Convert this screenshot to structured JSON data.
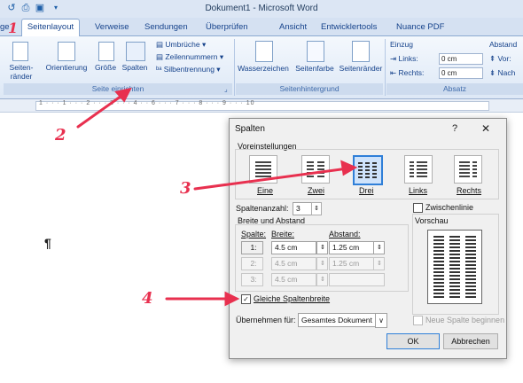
{
  "window": {
    "title": "Dokument1 - Microsoft Word"
  },
  "tabs": [
    "ge",
    "Seitenlayout",
    "Verweise",
    "Sendungen",
    "Überprüfen",
    "Ansicht",
    "Entwicklertools",
    "Nuance PDF"
  ],
  "ribbon": {
    "seite_einrichten": {
      "label": "Seite einrichten",
      "seitenraender": "Seiten-\nränder",
      "orientierung": "Orientierung",
      "groesse": "Größe",
      "spalten": "Spalten",
      "umbrueche": "Umbrüche",
      "zeilennummern": "Zeilennummern",
      "silbentrennung": "Silbentrennung"
    },
    "seitenhintergrund": {
      "label": "Seitenhintergrund",
      "wasserzeichen": "Wasserzeichen",
      "seitenfarbe": "Seitenfarbe",
      "seitenraender": "Seitenränder"
    },
    "absatz": {
      "label": "Absatz",
      "einzug": "Einzug",
      "links_label": "Links:",
      "links_value": "0 cm",
      "rechts_label": "Rechts:",
      "rechts_value": "0 cm",
      "abstand": "Abstand",
      "vor": "Vor:",
      "nach": "Nach"
    }
  },
  "ruler": {
    "ticks": "1 · · · 1 · · · 2 · · · 3 · · · 4 · ·   6 · · · 7 · · · 8 · · · 9 · · · 10"
  },
  "document": {
    "pilcrow": "¶"
  },
  "annotations": [
    "1",
    "2",
    "3",
    "4"
  ],
  "dialog": {
    "title": "Spalten",
    "help": "?",
    "close": "✕",
    "presets_label": "Voreinstellungen",
    "presets": [
      "Eine",
      "Zwei",
      "Drei",
      "Links",
      "Rechts"
    ],
    "selected_preset": "Drei",
    "spaltenanzahl_label": "Spaltenanzahl:",
    "spaltenanzahl_value": "3",
    "zwischenlinie": "Zwischenlinie",
    "zwischenlinie_checked": false,
    "breite_abstand_label": "Breite und Abstand",
    "col_spalte": "Spalte:",
    "col_breite": "Breite:",
    "col_abstand": "Abstand:",
    "rows": [
      {
        "num": "1:",
        "breite": "4.5 cm",
        "abstand": "1.25 cm"
      },
      {
        "num": "2:",
        "breite": "4.5 cm",
        "abstand": "1.25 cm"
      },
      {
        "num": "3:",
        "breite": "4.5 cm",
        "abstand": ""
      }
    ],
    "gleiche_spaltenbreite": "Gleiche Spaltenbreite",
    "gleiche_checked": true,
    "vorschau_label": "Vorschau",
    "uebernehmen_label": "Übernehmen für:",
    "uebernehmen_value": "Gesamtes Dokument",
    "neue_spalte": "Neue Spalte beginnen",
    "ok": "OK",
    "abbrechen": "Abbrechen"
  },
  "colors": {
    "arrow": "#e8304f",
    "accent": "#2f7fd8",
    "ribbon_text": "#15428b"
  }
}
